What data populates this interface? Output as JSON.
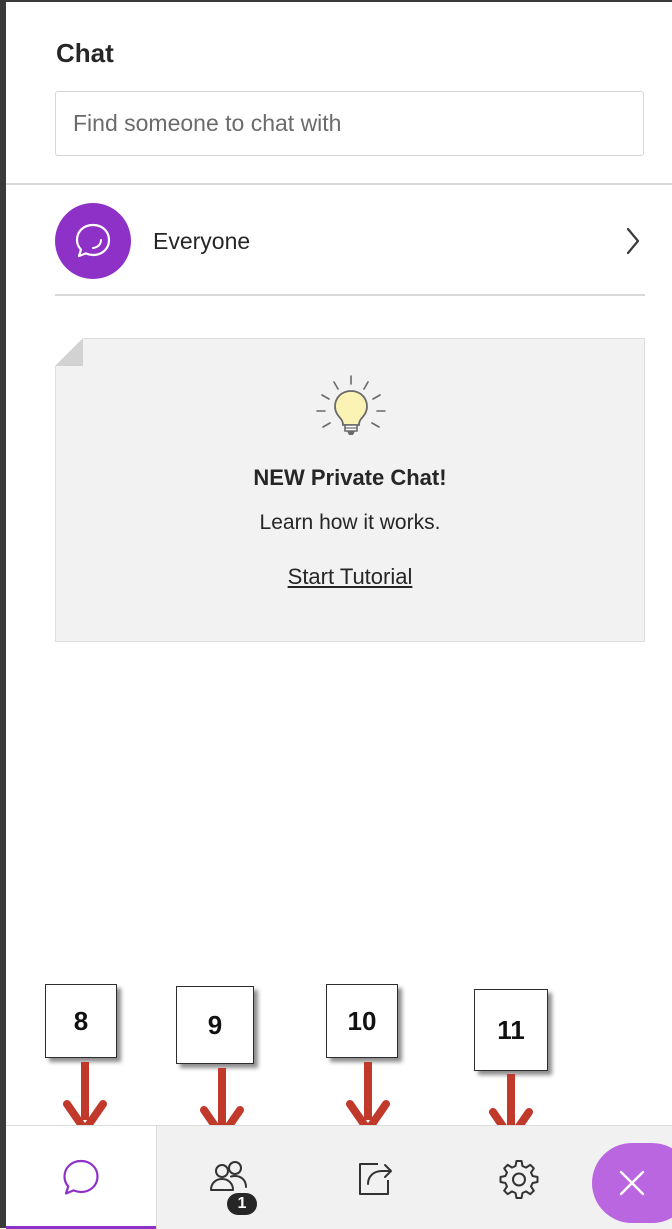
{
  "panel": {
    "title": "Chat"
  },
  "search": {
    "placeholder": "Find someone to chat with",
    "value": ""
  },
  "channels": [
    {
      "label": "Everyone",
      "icon": "chat-bubble-icon"
    }
  ],
  "tutorial": {
    "title": "NEW Private Chat!",
    "subtitle": "Learn how it works.",
    "link_label": "Start Tutorial",
    "icon": "lightbulb-icon"
  },
  "callouts": [
    {
      "label": "8",
      "target": "chat-tab"
    },
    {
      "label": "9",
      "target": "participants-tab"
    },
    {
      "label": "10",
      "target": "share-content-tab"
    },
    {
      "label": "11",
      "target": "settings-tab"
    }
  ],
  "bottom_bar": {
    "tabs": [
      {
        "id": "chat",
        "icon": "chat-bubble-icon",
        "active": true
      },
      {
        "id": "participants",
        "icon": "participants-icon",
        "badge": "1"
      },
      {
        "id": "share",
        "icon": "share-content-icon"
      },
      {
        "id": "settings",
        "icon": "gear-icon"
      }
    ],
    "close_icon": "close-icon"
  },
  "colors": {
    "accent": "#8e32c7",
    "close_button": "#b966e0",
    "callout_arrow": "#c0392b",
    "card_background": "#f2f2f2"
  }
}
